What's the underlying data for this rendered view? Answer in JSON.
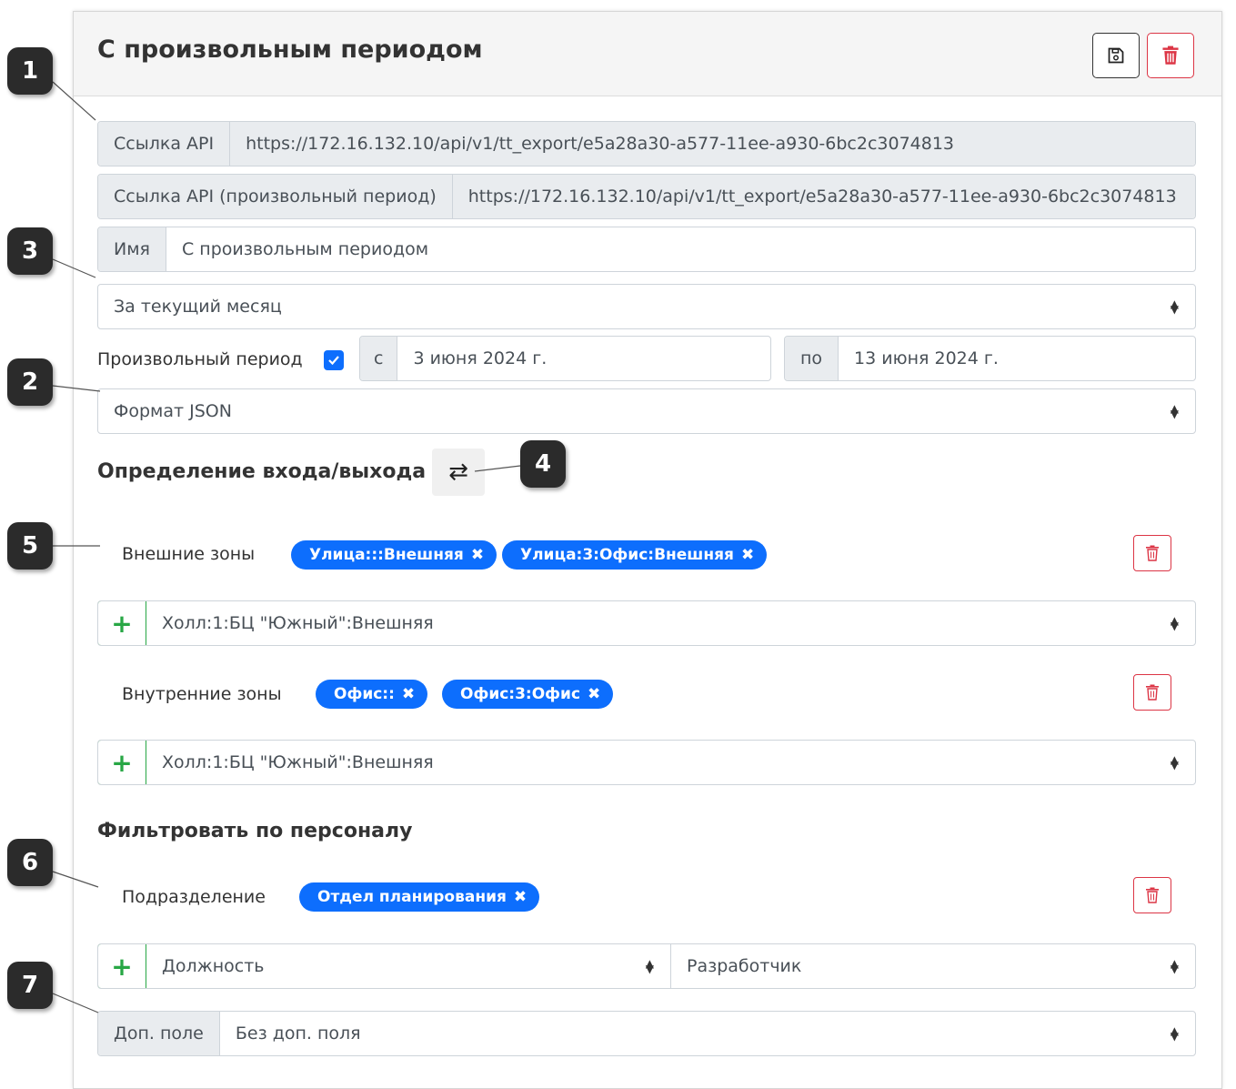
{
  "header": {
    "title": "С произвольным периодом"
  },
  "api": {
    "label": "Ссылка API",
    "url": "https://172.16.132.10/api/v1/tt_export/e5a28a30-a577-11ee-a930-6bc2c3074813",
    "custom_label": "Ссылка API (произвольный период)",
    "custom_url": "https://172.16.132.10/api/v1/tt_export/e5a28a30-a577-11ee-a930-6bc2c3074813"
  },
  "name": {
    "label": "Имя",
    "value": "С произвольным периодом"
  },
  "period_select": "За текущий месяц",
  "custom_period": {
    "label": "Произвольный период",
    "checked": true,
    "from_label": "с",
    "from_value": "3 июня 2024 г.",
    "to_label": "по",
    "to_value": "13 июня 2024 г."
  },
  "format_select": "Формат JSON",
  "entry_exit": {
    "title": "Определение входа/выхода",
    "outer_label": "Внешние зоны",
    "outer_tags": [
      "Улица:::Внешняя",
      "Улица:3:Офис:Внешняя"
    ],
    "outer_select": "Холл:1:БЦ \"Южный\":Внешняя",
    "inner_label": "Внутренние зоны",
    "inner_tags": [
      "Офис::",
      "Офис:3:Офис"
    ],
    "inner_select": "Холл:1:БЦ \"Южный\":Внешняя"
  },
  "staff_filter": {
    "title": "Фильтровать по персоналу",
    "dept_label": "Подразделение",
    "dept_tags": [
      "Отдел планирования"
    ],
    "field_select": "Должность",
    "value_select": "Разработчик",
    "extra_label": "Доп. поле",
    "extra_select": "Без доп. поля"
  },
  "callouts": [
    "1",
    "3",
    "2",
    "4",
    "5",
    "6",
    "7"
  ],
  "colors": {
    "primary": "#0d6efd",
    "danger": "#dc3545",
    "success": "#28a745",
    "badge": "#2b2b2b"
  }
}
